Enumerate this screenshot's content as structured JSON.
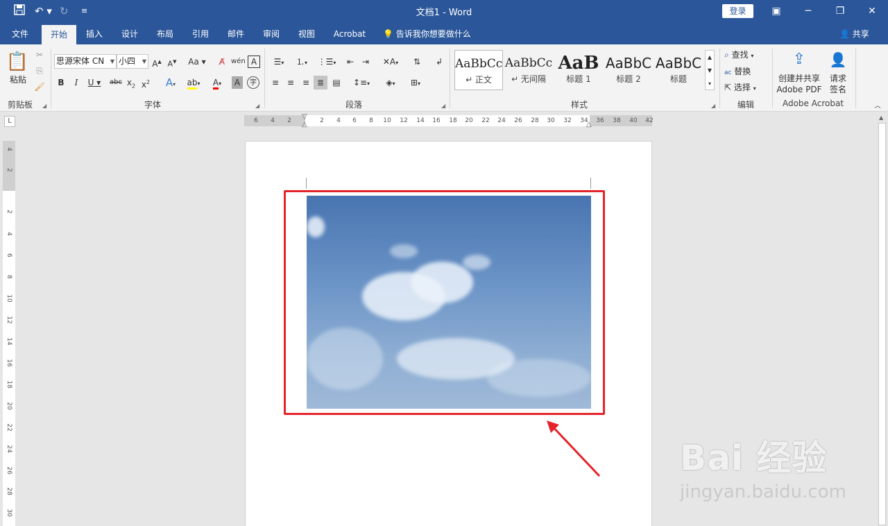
{
  "titlebar": {
    "title": "文档1  -  Word",
    "login": "登录",
    "save_icon": "save-icon",
    "undo_icon": "undo-icon",
    "redo_icon": "redo-icon"
  },
  "tabs": [
    "文件",
    "开始",
    "插入",
    "设计",
    "布局",
    "引用",
    "邮件",
    "审阅",
    "视图",
    "Acrobat"
  ],
  "tell_me": "告诉我你想要做什么",
  "share": "共享",
  "ribbon": {
    "clipboard": {
      "paste": "粘贴",
      "label": "剪贴板"
    },
    "font": {
      "name": "思源宋体 CN",
      "size": "小四",
      "label": "字体",
      "b": "B",
      "i": "I",
      "u": "U",
      "abc": "abc",
      "aa": "Aa"
    },
    "paragraph": {
      "label": "段落"
    },
    "styles": {
      "label": "样式",
      "items": [
        {
          "preview": "AaBbCc",
          "name": "↵ 正文"
        },
        {
          "preview": "AaBbCc",
          "name": "↵ 无间隔"
        },
        {
          "preview": "AaB",
          "name": "标题 1"
        },
        {
          "preview": "AaBbC",
          "name": "标题 2"
        },
        {
          "preview": "AaBbC",
          "name": "标题"
        }
      ]
    },
    "editing": {
      "find": "查找",
      "replace": "替换",
      "select": "选择",
      "label": "编辑"
    },
    "acrobat": {
      "create": "创建并共享",
      "create2": "Adobe PDF",
      "sign": "请求",
      "sign2": "签名",
      "label": "Adobe Acrobat"
    }
  },
  "ruler": {
    "h_ticks": [
      "6",
      "4",
      "2",
      "2",
      "4",
      "6",
      "8",
      "10",
      "12",
      "14",
      "16",
      "18",
      "20",
      "22",
      "24",
      "26",
      "28",
      "30",
      "32",
      "34",
      "36",
      "38",
      "40",
      "42"
    ],
    "v_ticks": [
      "4",
      "2",
      "2",
      "4",
      "6",
      "8",
      "10",
      "12",
      "14",
      "16",
      "18",
      "20",
      "22",
      "24",
      "26",
      "28",
      "30"
    ],
    "corner": "L"
  },
  "watermark": {
    "line1": "Bai 经验",
    "line2": "jingyan.baidu.com"
  }
}
